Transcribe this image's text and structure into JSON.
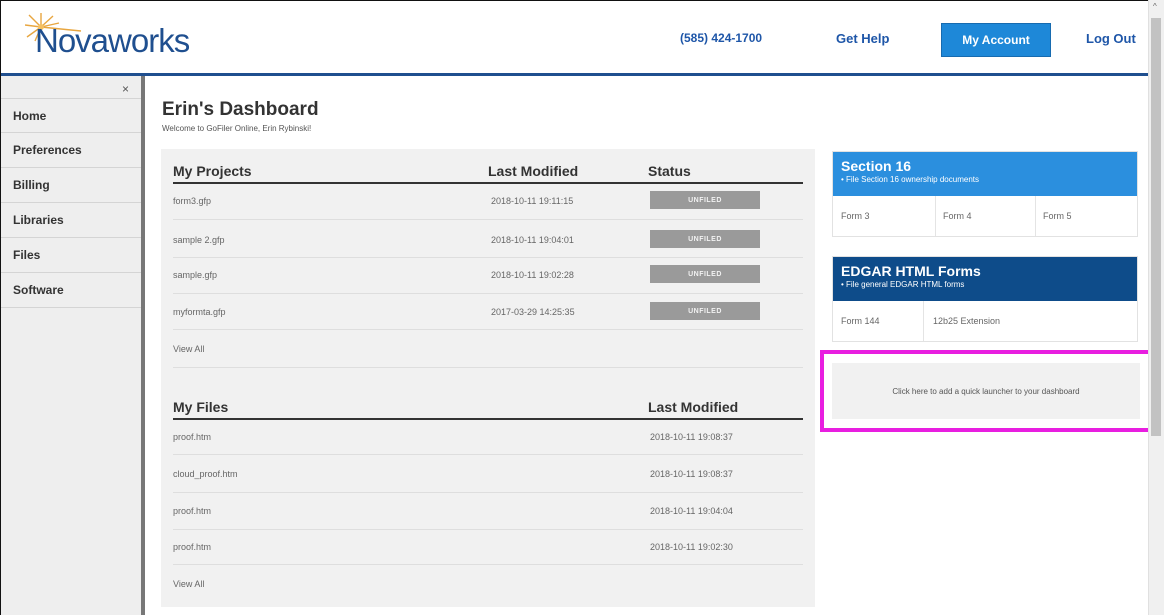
{
  "header": {
    "logo_text": "Novaworks",
    "phone": "(585) 424-1700",
    "get_help": "Get Help",
    "my_account": "My Account",
    "log_out": "Log Out"
  },
  "sidebar": {
    "close": "×",
    "items": [
      "Home",
      "Preferences",
      "Billing",
      "Libraries",
      "Files",
      "Software"
    ]
  },
  "dashboard": {
    "title": "Erin's Dashboard",
    "welcome": "Welcome to GoFiler Online, Erin Rybinski!"
  },
  "projects": {
    "headers": {
      "name": "My Projects",
      "modified": "Last Modified",
      "status": "Status"
    },
    "rows": [
      {
        "name": "form3.gfp",
        "modified": "2018-10-11 19:11:15",
        "status": "UNFILED"
      },
      {
        "name": "sample 2.gfp",
        "modified": "2018-10-11 19:04:01",
        "status": "UNFILED"
      },
      {
        "name": "sample.gfp",
        "modified": "2018-10-11 19:02:28",
        "status": "UNFILED"
      },
      {
        "name": "myformta.gfp",
        "modified": "2017-03-29 14:25:35",
        "status": "UNFILED"
      }
    ],
    "view_all": "View All"
  },
  "files": {
    "headers": {
      "name": "My Files",
      "modified": "Last Modified"
    },
    "rows": [
      {
        "name": "proof.htm",
        "modified": "2018-10-11 19:08:37"
      },
      {
        "name": "cloud_proof.htm",
        "modified": "2018-10-11 19:08:37"
      },
      {
        "name": "proof.htm",
        "modified": "2018-10-11 19:04:04"
      },
      {
        "name": "proof.htm",
        "modified": "2018-10-11 19:02:30"
      }
    ],
    "view_all": "View All"
  },
  "launchers": [
    {
      "title": "Section 16",
      "subtitle": "• File Section 16 ownership documents",
      "color": "#2b8fde",
      "forms": [
        "Form 3",
        "Form 4",
        "Form 5"
      ]
    },
    {
      "title": "EDGAR HTML Forms",
      "subtitle": "• File general EDGAR HTML forms",
      "color": "#0e4c8a",
      "forms": [
        "Form 144",
        "12b25 Extension"
      ]
    }
  ],
  "add_launcher": "Click here to add a quick launcher to your dashboard",
  "colors": {
    "brand": "#1f4f8f",
    "account_button": "#1e88d8",
    "highlight": "#e81ee0"
  },
  "scrollbar": {
    "up_arrow": "^"
  }
}
